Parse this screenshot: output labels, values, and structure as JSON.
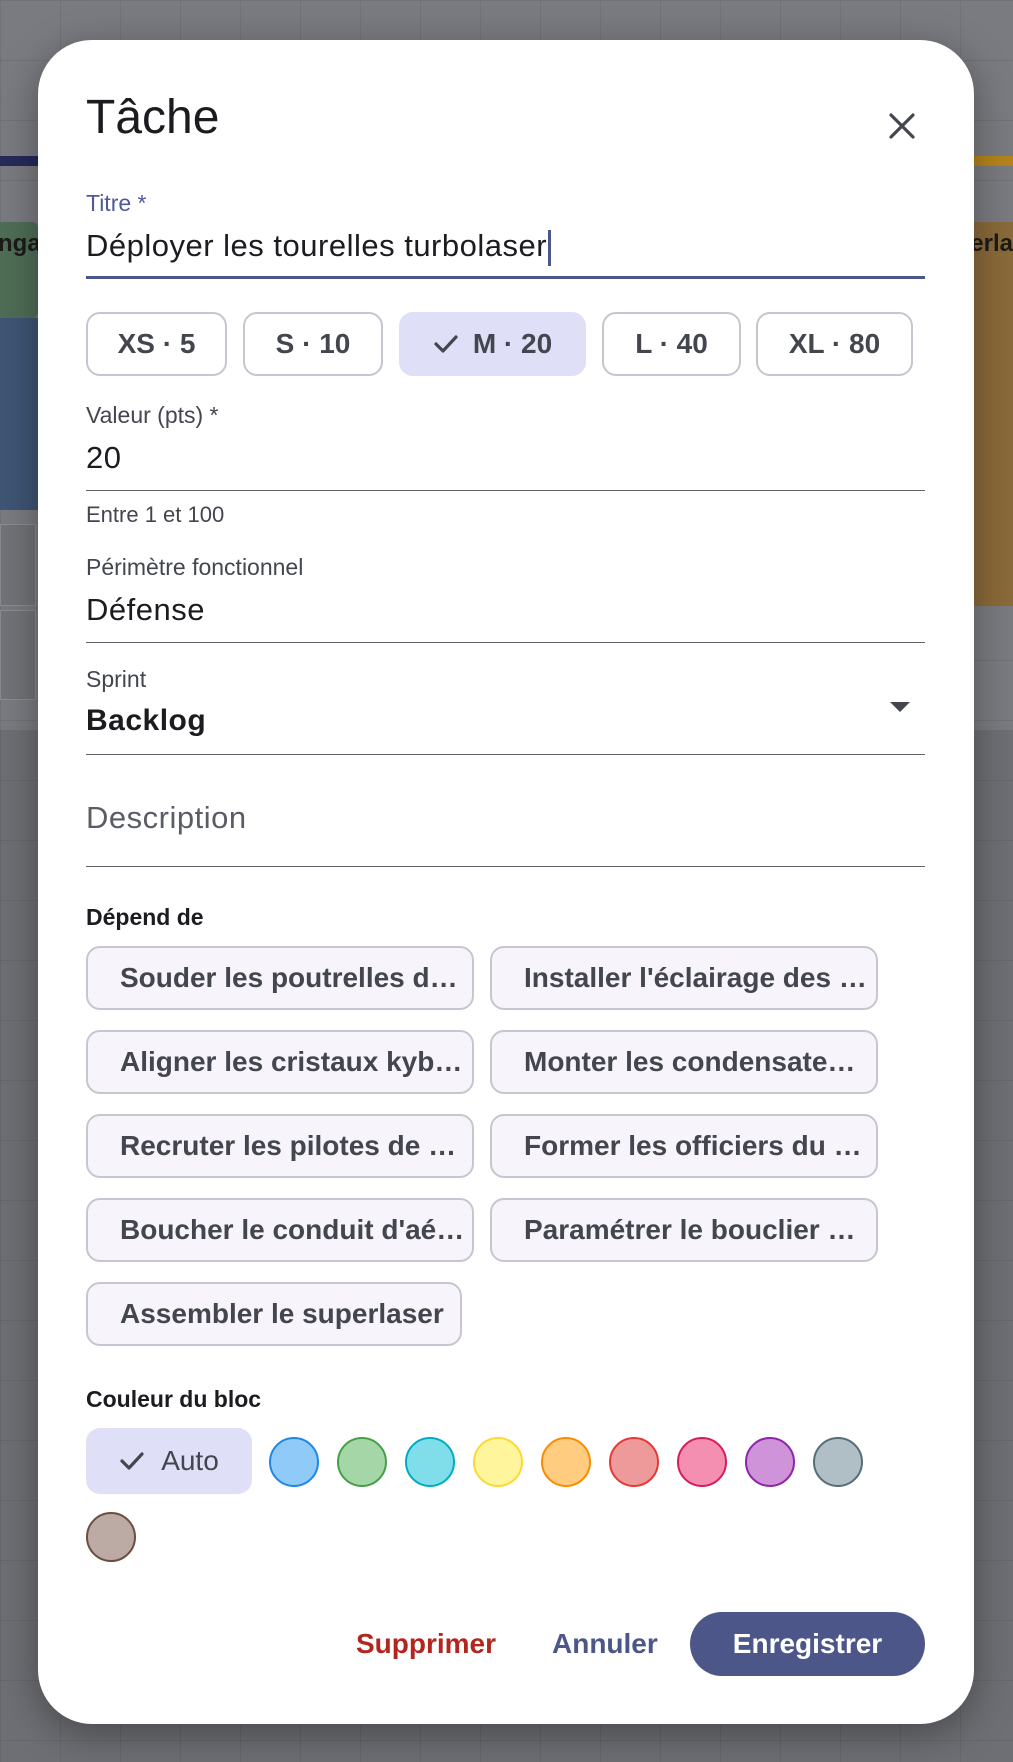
{
  "background": {
    "left_edge_text": "nga",
    "right_edge_text": "erla"
  },
  "dialog": {
    "title": "Tâche",
    "close_icon": "close-icon"
  },
  "fields": {
    "title_label": "Titre *",
    "title_value": "Déployer les tourelles turbolaser",
    "value_label": "Valeur (pts) *",
    "value_value": "20",
    "value_helper": "Entre 1 et 100",
    "scope_label": "Périmètre fonctionnel",
    "scope_value": "Défense",
    "sprint_label": "Sprint",
    "sprint_value": "Backlog",
    "description_placeholder": "Description"
  },
  "sizes": [
    {
      "label": "XS · 5",
      "selected": false
    },
    {
      "label": "S · 10",
      "selected": false
    },
    {
      "label": "M · 20",
      "selected": true
    },
    {
      "label": "L · 40",
      "selected": false
    },
    {
      "label": "XL · 80",
      "selected": false
    }
  ],
  "dependencies": {
    "title": "Dépend de",
    "items": [
      "Souder les poutrelles d…",
      "Installer l'éclairage des …",
      "Aligner les cristaux kyb…",
      "Monter les condensate…",
      "Recruter les pilotes de …",
      "Former les officiers du …",
      "Boucher le conduit d'aé…",
      "Paramétrer le bouclier …",
      "Assembler le superlaser"
    ]
  },
  "colors": {
    "title": "Couleur du bloc",
    "auto_label": "Auto",
    "auto_selected": true,
    "swatches": [
      {
        "name": "blue",
        "fill": "#90caf9",
        "border": "#1e88e5"
      },
      {
        "name": "green",
        "fill": "#a5d6a7",
        "border": "#43a047"
      },
      {
        "name": "cyan",
        "fill": "#80deea",
        "border": "#00acc1"
      },
      {
        "name": "yellow",
        "fill": "#fff59d",
        "border": "#fdd835"
      },
      {
        "name": "orange",
        "fill": "#ffcc80",
        "border": "#fb8c00"
      },
      {
        "name": "red",
        "fill": "#ef9a9a",
        "border": "#e53935"
      },
      {
        "name": "pink",
        "fill": "#f48fb1",
        "border": "#d81b60"
      },
      {
        "name": "purple",
        "fill": "#ce93d8",
        "border": "#8e24aa"
      },
      {
        "name": "blue-grey",
        "fill": "#b0bec5",
        "border": "#546e7a"
      },
      {
        "name": "brown",
        "fill": "#bcaaa4",
        "border": "#6d4c41"
      }
    ]
  },
  "actions": {
    "delete_label": "Supprimer",
    "cancel_label": "Annuler",
    "save_label": "Enregistrer",
    "delete_color": "#b3261e",
    "accent_color": "#4c5689"
  }
}
